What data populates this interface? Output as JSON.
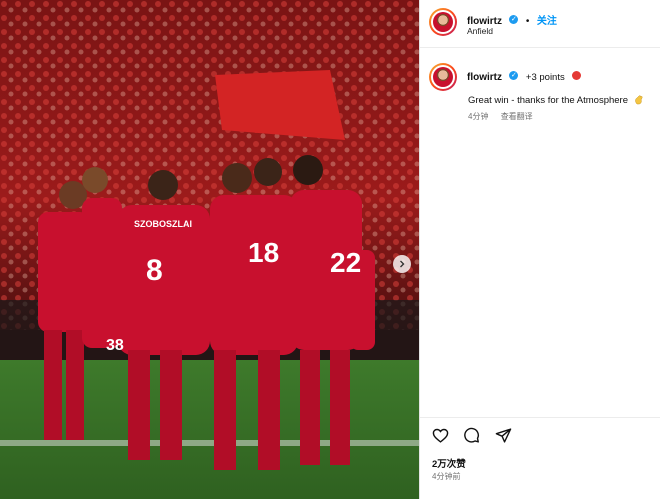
{
  "post": {
    "username": "flowirtz",
    "follow_label": "关注",
    "location": "Anfield",
    "separator": "•"
  },
  "comment": {
    "username": "flowirtz",
    "points_text": "+3 points",
    "caption": "Great win - thanks for the Atmosphere",
    "time": "4分钟",
    "translate_label": "查看翻译"
  },
  "engagement": {
    "likes": "2万次赞",
    "time_ago": "4分钟前"
  },
  "photo": {
    "jersey_numbers": [
      "8",
      "18",
      "22",
      "38"
    ],
    "jersey_names": [
      "SZOBOSZLAI",
      "SZ"
    ],
    "kit_color": "#c8102e"
  },
  "colors": {
    "accent": "#0095f6",
    "verified": "#1d9bf0",
    "muted": "#737373"
  },
  "icons": [
    "verified-badge-icon",
    "red-circle-icon",
    "clapping-hand-icon",
    "heart-icon",
    "comment-icon",
    "share-icon",
    "chevron-right-icon"
  ]
}
